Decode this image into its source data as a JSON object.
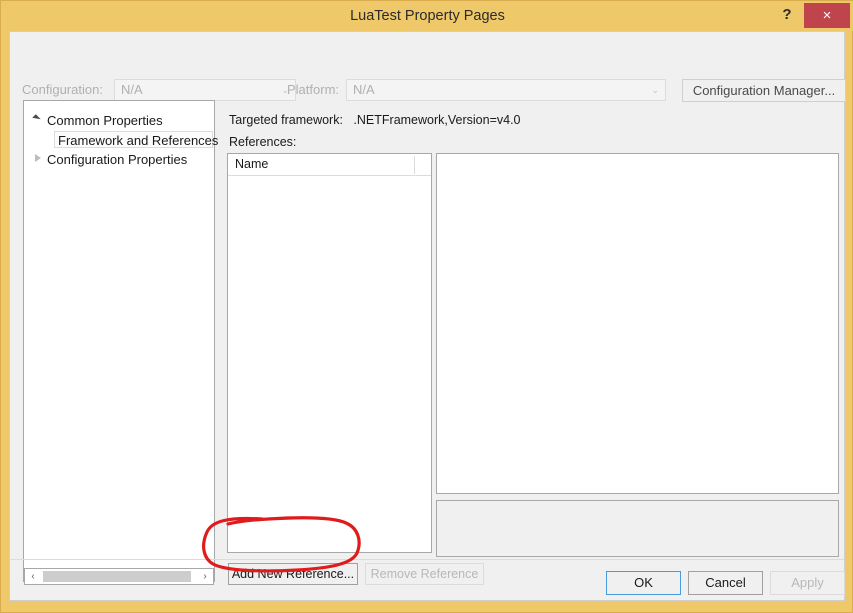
{
  "window": {
    "title": "LuaTest Property Pages",
    "help_icon": "?",
    "close_icon": "×",
    "titlebar_color": "#efc969",
    "close_button_color": "#c0444c"
  },
  "config_bar": {
    "configuration_label": "Configuration:",
    "configuration_value": "N/A",
    "platform_label": "Platform:",
    "platform_value": "N/A",
    "dropdown_arrow": "⌄",
    "configuration_manager_label": "Configuration Manager..."
  },
  "tree": {
    "items": [
      {
        "label": "Common Properties",
        "expander": "expanded-triangle-icon",
        "selected": false
      },
      {
        "label": "Framework and References",
        "expander": "none",
        "selected": true
      },
      {
        "label": "Configuration Properties",
        "expander": "collapsed-triangle-icon",
        "selected": false
      }
    ],
    "scrollbar": {
      "left_arrow": "‹",
      "right_arrow": "›"
    }
  },
  "main": {
    "framework_label": "Targeted framework:",
    "framework_value": ".NETFramework,Version=v4.0",
    "references_label": "References:",
    "list": {
      "column_header": "Name",
      "rows": []
    },
    "detail_panel_content": "",
    "description_panel_content": ""
  },
  "actions": {
    "add_reference_label": "Add New Reference...",
    "remove_reference_label": "Remove Reference",
    "remove_reference_enabled": false
  },
  "footer": {
    "ok_label": "OK",
    "cancel_label": "Cancel",
    "apply_label": "Apply",
    "apply_enabled": false,
    "ok_focused": true
  },
  "annotation": {
    "type": "hand-drawn-ellipse",
    "color": "#e01b1b",
    "target": "Add New Reference..."
  }
}
